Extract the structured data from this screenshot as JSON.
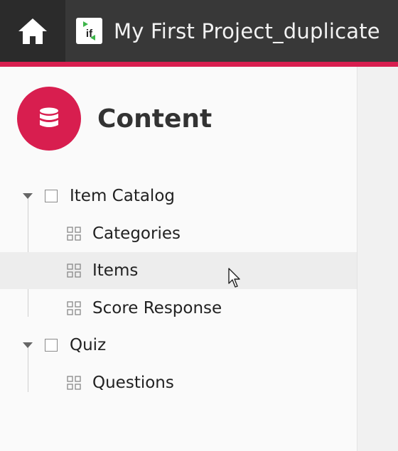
{
  "header": {
    "home_icon": "home-icon",
    "app_logo_text": "if",
    "project_title": "My First Project_duplicate",
    "accent_color": "#d81e4f"
  },
  "sidebar": {
    "section_icon": "database-icon",
    "section_title": "Content",
    "groups": [
      {
        "label": "Item Catalog",
        "expanded": true,
        "items": [
          {
            "label": "Categories",
            "icon": "grid-icon"
          },
          {
            "label": "Items",
            "icon": "grid-icon",
            "highlighted": true
          },
          {
            "label": "Score Response",
            "icon": "grid-icon"
          }
        ]
      },
      {
        "label": "Quiz",
        "expanded": true,
        "items": [
          {
            "label": "Questions",
            "icon": "grid-icon"
          }
        ]
      }
    ]
  }
}
